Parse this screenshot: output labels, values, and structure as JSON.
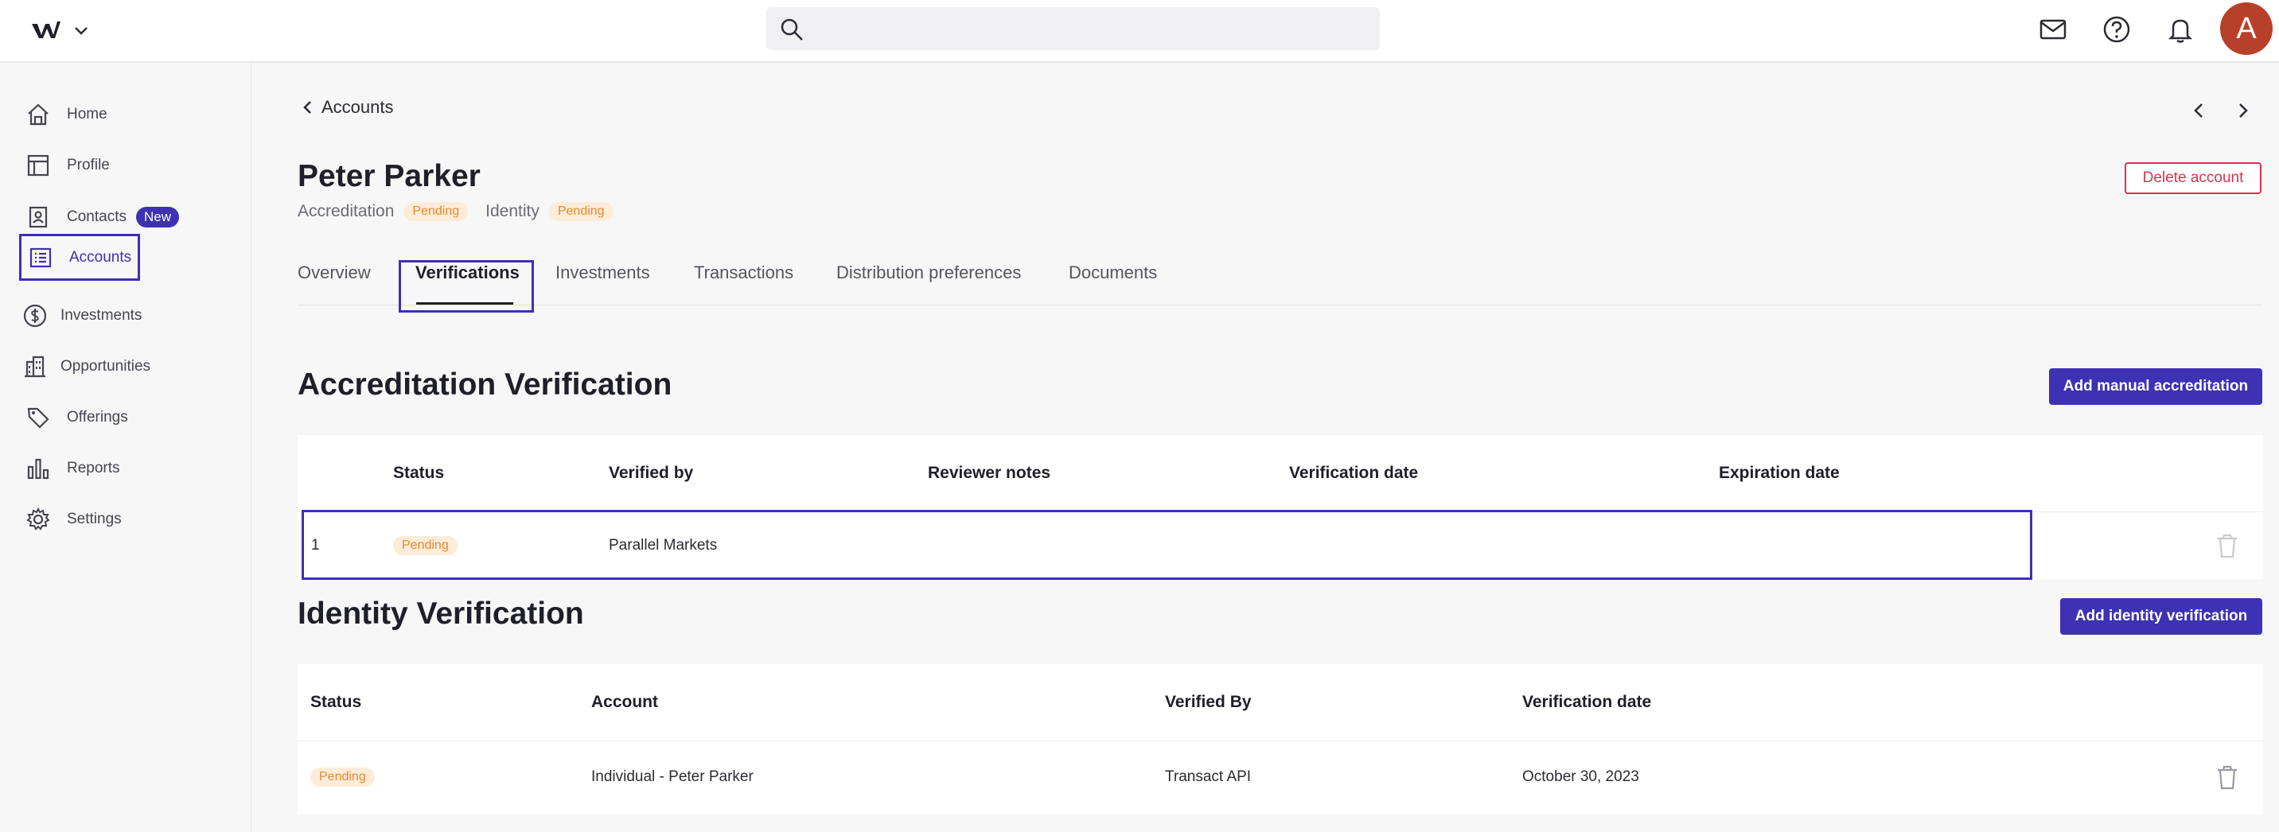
{
  "header": {
    "logo_icon": "logo-icon",
    "search_placeholder": "",
    "avatar_initial": "A"
  },
  "sidebar": {
    "items": [
      {
        "label": "Home",
        "icon": "home-icon"
      },
      {
        "label": "Profile",
        "icon": "profile-icon"
      },
      {
        "label": "Contacts",
        "icon": "contacts-icon",
        "badge": "New"
      },
      {
        "label": "Accounts",
        "icon": "accounts-icon",
        "active": true
      },
      {
        "label": "Investments",
        "icon": "dollar-icon"
      },
      {
        "label": "Opportunities",
        "icon": "building-icon"
      },
      {
        "label": "Offerings",
        "icon": "tag-icon"
      },
      {
        "label": "Reports",
        "icon": "bar-chart-icon"
      },
      {
        "label": "Settings",
        "icon": "gear-icon"
      }
    ]
  },
  "main": {
    "back_label": "Accounts",
    "account_name": "Peter Parker",
    "accreditation_label": "Accreditation",
    "accreditation_status": "Pending",
    "identity_label": "Identity",
    "identity_status": "Pending",
    "delete_label": "Delete account",
    "tabs": [
      {
        "label": "Overview"
      },
      {
        "label": "Verifications",
        "active": true
      },
      {
        "label": "Investments"
      },
      {
        "label": "Transactions"
      },
      {
        "label": "Distribution preferences"
      },
      {
        "label": "Documents"
      }
    ]
  },
  "accreditation": {
    "title": "Accreditation Verification",
    "button_label": "Add manual accreditation",
    "columns": [
      "Status",
      "Verified by",
      "Reviewer notes",
      "Verification date",
      "Expiration date"
    ],
    "rows": [
      {
        "index": "1",
        "status": "Pending",
        "verified_by": "Parallel Markets",
        "reviewer_notes": "",
        "verification_date": "",
        "expiration_date": ""
      }
    ]
  },
  "identity": {
    "title": "Identity Verification",
    "button_label": "Add identity verification",
    "columns": [
      "Status",
      "Account",
      "Verified By",
      "Verification date"
    ],
    "rows": [
      {
        "status": "Pending",
        "account": "Individual - Peter Parker",
        "verified_by": "Transact API",
        "verification_date": "October 30, 2023"
      }
    ]
  },
  "colors": {
    "accent": "#3d32b3",
    "danger": "#d8334f",
    "pending_bg": "#fdecd9",
    "pending_text": "#e88a2e",
    "avatar": "#b8402a"
  }
}
